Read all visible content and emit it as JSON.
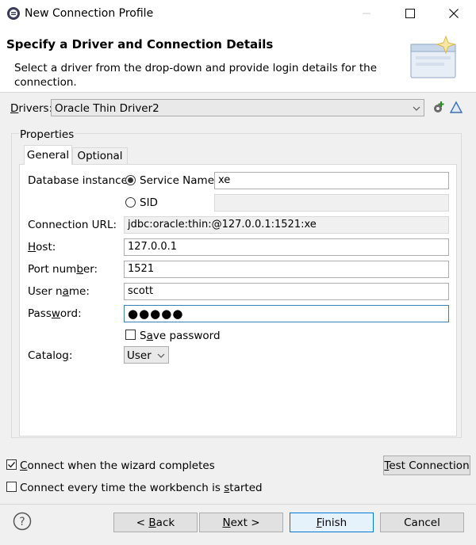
{
  "window": {
    "title": "New Connection Profile"
  },
  "header": {
    "title": "Specify a Driver and Connection Details",
    "description": "Select a driver from the drop-down and provide login details for the connection."
  },
  "drivers": {
    "label": "Drivers:",
    "value": "Oracle Thin Driver2"
  },
  "properties": {
    "group_label": "Properties",
    "tabs": [
      {
        "label": "General",
        "selected": true
      },
      {
        "label": "Optional",
        "selected": false
      }
    ],
    "db_instance_label": "Database instance:",
    "service_name_label": "Service Name",
    "service_name_value": "xe",
    "sid_label": "SID",
    "sid_value": "",
    "url_label": "Connection URL:",
    "url_value": "jdbc:oracle:thin:@127.0.0.1:1521:xe",
    "host_label": "Host:",
    "host_value": "127.0.0.1",
    "port_label": "Port number:",
    "port_value": "1521",
    "user_label": "User name:",
    "user_value": "scott",
    "password_label": "Password:",
    "password_value": "●●●●●",
    "save_password_label": "Save password",
    "catalog_label": "Catalog:",
    "catalog_value": "User"
  },
  "options": {
    "connect_when_completes": "Connect when the wizard completes",
    "connect_when_completes_checked": true,
    "connect_every_time": "Connect every time the workbench is started",
    "connect_every_time_checked": false
  },
  "buttons": {
    "test_connection": "Test Connection",
    "back": "< Back",
    "next": "Next >",
    "finish": "Finish",
    "cancel": "Cancel"
  },
  "colors": {
    "accent": "#0078d7",
    "focus_border": "#3c7fb1"
  }
}
